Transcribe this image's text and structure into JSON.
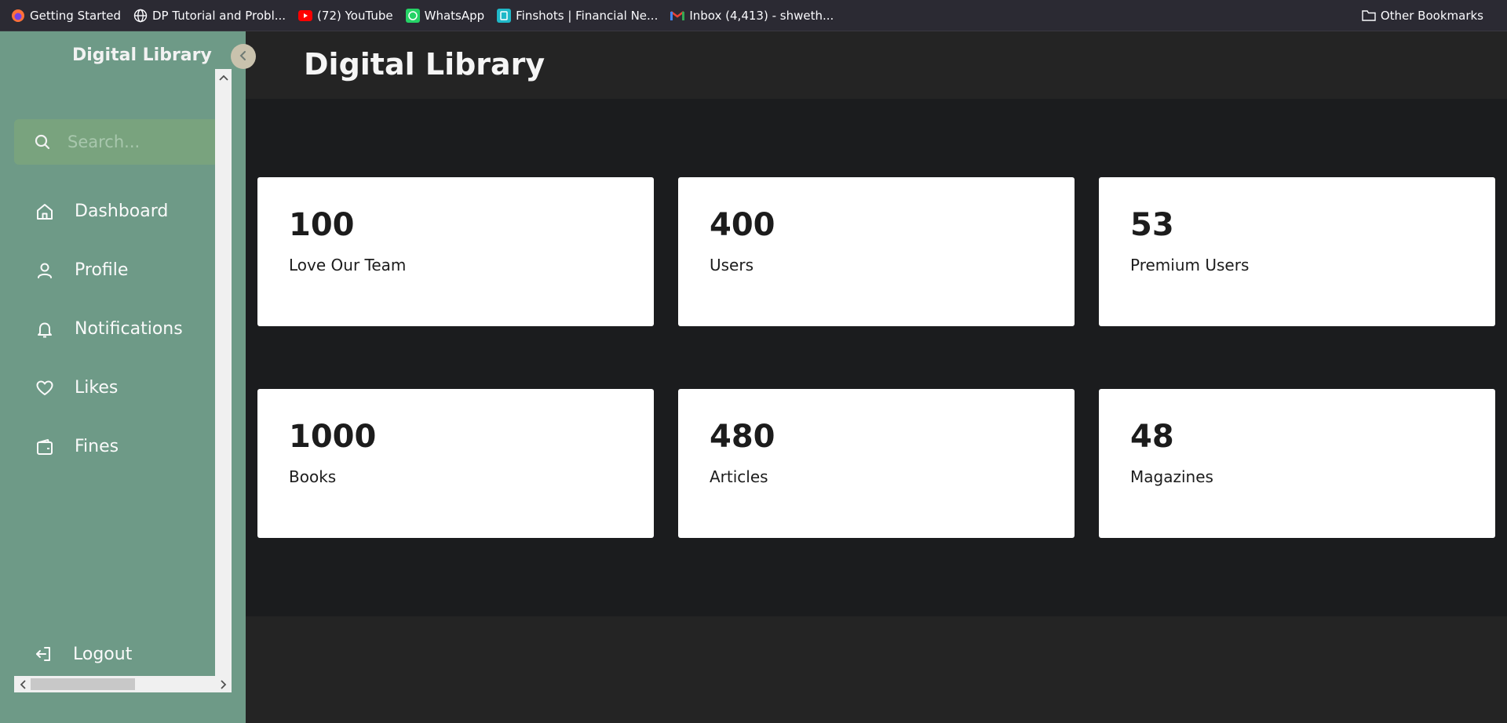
{
  "bookmarks": {
    "items": [
      {
        "label": "Getting Started",
        "icon": "firefox-icon"
      },
      {
        "label": "DP Tutorial and Probl...",
        "icon": "globe-icon"
      },
      {
        "label": "(72) YouTube",
        "icon": "youtube-icon"
      },
      {
        "label": "WhatsApp",
        "icon": "whatsapp-icon"
      },
      {
        "label": "Finshots | Financial Ne...",
        "icon": "finshots-icon"
      },
      {
        "label": "Inbox (4,413) - shweth...",
        "icon": "gmail-icon"
      }
    ],
    "other": "Other Bookmarks"
  },
  "sidebar": {
    "brand": "Digital Library",
    "search_placeholder": "Search...",
    "items": [
      {
        "label": "Dashboard",
        "icon": "home-icon"
      },
      {
        "label": "Profile",
        "icon": "user-icon"
      },
      {
        "label": "Notifications",
        "icon": "bell-icon"
      },
      {
        "label": "Likes",
        "icon": "heart-icon"
      },
      {
        "label": "Fines",
        "icon": "wallet-icon"
      }
    ],
    "logout": "Logout"
  },
  "main": {
    "title": "Digital Library",
    "cards": [
      {
        "value": "100",
        "label": "Love Our Team"
      },
      {
        "value": "400",
        "label": "Users"
      },
      {
        "value": "53",
        "label": "Premium Users"
      },
      {
        "value": "1000",
        "label": "Books"
      },
      {
        "value": "480",
        "label": "Articles"
      },
      {
        "value": "48",
        "label": "Magazines"
      }
    ]
  },
  "colors": {
    "sidebar_bg": "#6e9a87",
    "search_bg": "#79a37e",
    "header_bg": "#242424",
    "content_bg": "#1b1c1e",
    "card_bg": "#ffffff",
    "bookmarks_bg": "#2b2a33"
  }
}
